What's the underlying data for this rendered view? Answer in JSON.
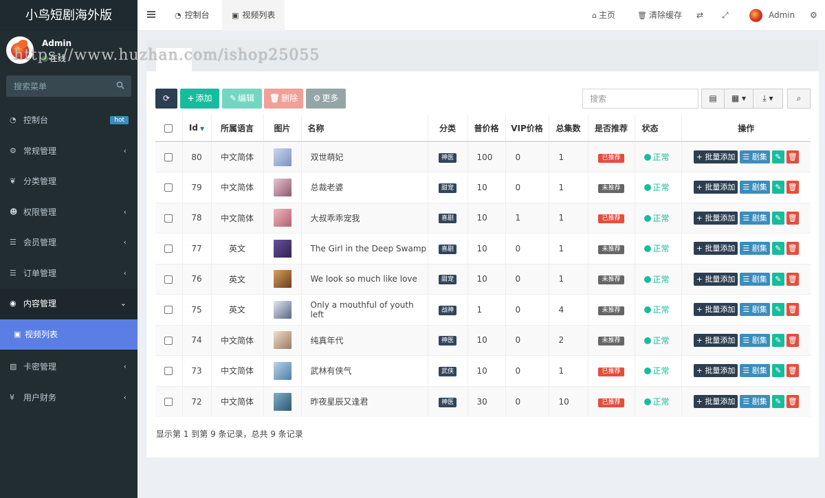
{
  "app": {
    "title": "小鸟短剧海外版"
  },
  "user": {
    "name": "Admin",
    "status": "在线"
  },
  "watermark": "https://www.huzhan.com/ishop25055",
  "sidebar": {
    "search_placeholder": "搜索菜单",
    "items": [
      {
        "label": "控制台",
        "icon": "dashboard-icon",
        "badge": "hot"
      },
      {
        "label": "常规管理",
        "icon": "cogs-icon"
      },
      {
        "label": "分类管理",
        "icon": "leaf-icon"
      },
      {
        "label": "权限管理",
        "icon": "group-icon"
      },
      {
        "label": "会员管理",
        "icon": "list-icon"
      },
      {
        "label": "订单管理",
        "icon": "list-icon"
      },
      {
        "label": "内容管理",
        "icon": "chrome-icon"
      },
      {
        "label": "视频列表",
        "icon": "file-video-icon"
      },
      {
        "label": "卡密管理",
        "icon": "image-icon"
      },
      {
        "label": "用户财务",
        "icon": "yen-icon"
      }
    ]
  },
  "header": {
    "tabs": [
      {
        "label": "控制台"
      },
      {
        "label": "视频列表"
      }
    ],
    "home": "主页",
    "clear_cache": "清除缓存",
    "admin": "Admin"
  },
  "content": {
    "toolbar": {
      "add": "添加",
      "edit": "编辑",
      "delete": "删除",
      "more": "更多"
    },
    "search_placeholder": "搜索",
    "columns": [
      "Id",
      "所属语言",
      "图片",
      "名称",
      "分类",
      "普价格",
      "VIP价格",
      "总集数",
      "是否推荐",
      "状态",
      "操作"
    ],
    "rows": [
      {
        "id": "80",
        "lang": "中文简体",
        "name": "双世萌妃",
        "cat": "神医",
        "price": "100",
        "vip": "0",
        "eps": "1",
        "rec": "已推荐",
        "status": "正常",
        "thumb": [
          "#c9d6ea",
          "#7a93c4"
        ]
      },
      {
        "id": "79",
        "lang": "中文简体",
        "name": "总裁老婆",
        "cat": "甜宠",
        "price": "10",
        "vip": "0",
        "eps": "1",
        "rec": "未推荐",
        "status": "正常",
        "thumb": [
          "#e8c3cf",
          "#8c5a6e"
        ]
      },
      {
        "id": "78",
        "lang": "中文简体",
        "name": "大叔乖乖宠我",
        "cat": "喜剧",
        "price": "10",
        "vip": "1",
        "eps": "1",
        "rec": "已推荐",
        "status": "正常",
        "thumb": [
          "#f0b8c0",
          "#b06070"
        ]
      },
      {
        "id": "77",
        "lang": "英文",
        "name": "The Girl in the Deep Swamp",
        "cat": "喜剧",
        "price": "10",
        "vip": "0",
        "eps": "1",
        "rec": "未推荐",
        "status": "正常",
        "thumb": [
          "#6a4fa0",
          "#2e2450"
        ]
      },
      {
        "id": "76",
        "lang": "英文",
        "name": "We look so much like love",
        "cat": "甜宠",
        "price": "10",
        "vip": "0",
        "eps": "1",
        "rec": "未推荐",
        "status": "正常",
        "thumb": [
          "#d9a25a",
          "#6b3a1e"
        ]
      },
      {
        "id": "75",
        "lang": "英文",
        "name": "Only a mouthful of youth left",
        "cat": "战神",
        "price": "1",
        "vip": "0",
        "eps": "4",
        "rec": "未推荐",
        "status": "正常",
        "thumb": [
          "#e6e6ee",
          "#556688"
        ]
      },
      {
        "id": "74",
        "lang": "中文简体",
        "name": "纯真年代",
        "cat": "神医",
        "price": "10",
        "vip": "0",
        "eps": "2",
        "rec": "未推荐",
        "status": "正常",
        "thumb": [
          "#f2dcc8",
          "#9a7a66"
        ]
      },
      {
        "id": "73",
        "lang": "中文简体",
        "name": "武林有侠气",
        "cat": "武侠",
        "price": "10",
        "vip": "0",
        "eps": "1",
        "rec": "已推荐",
        "status": "正常",
        "thumb": [
          "#b8d4ea",
          "#4e7ea8"
        ]
      },
      {
        "id": "72",
        "lang": "中文简体",
        "name": "昨夜星辰又逢君",
        "cat": "神医",
        "price": "30",
        "vip": "0",
        "eps": "10",
        "rec": "已推荐",
        "status": "正常",
        "thumb": [
          "#7fb0c8",
          "#2c5670"
        ]
      }
    ],
    "row_actions": {
      "batch_add": "批量添加",
      "episodes": "剧集"
    },
    "footer": "显示第 1 到第 9 条记录，总共 9 条记录"
  },
  "colors": {
    "recommended": "#e74c3c",
    "not_recommended": "#666666",
    "status": "#18bc9c"
  }
}
